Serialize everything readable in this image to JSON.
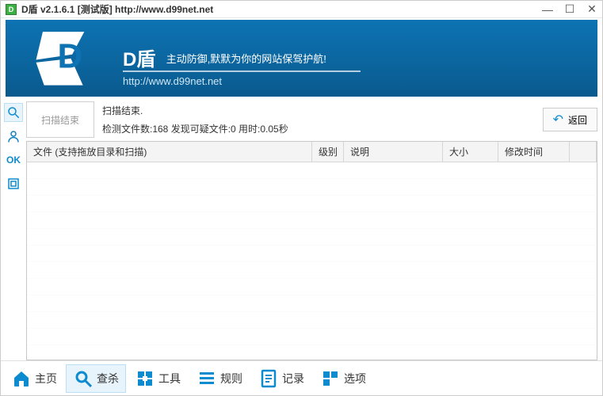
{
  "window": {
    "title": "D盾 v2.1.6.1 [测试版] http://www.d99net.net"
  },
  "banner": {
    "brand": "D盾",
    "slogan": "主动防御,默默为你的网站保驾护航!",
    "url": "http://www.d99net.net"
  },
  "status": {
    "box_label": "扫描结束",
    "line1": "扫描结束.",
    "line2": "检测文件数:168 发现可疑文件:0 用时:0.05秒",
    "back_label": "返回"
  },
  "columns": {
    "file": "文件 (支持拖放目录和扫描)",
    "level": "级别",
    "desc": "说明",
    "size": "大小",
    "mtime": "修改时间"
  },
  "sidebar_ok": "OK",
  "nav": {
    "home": "主页",
    "killsoft": "查杀",
    "tools": "工具",
    "rules": "规则",
    "records": "记录",
    "options": "选项"
  }
}
